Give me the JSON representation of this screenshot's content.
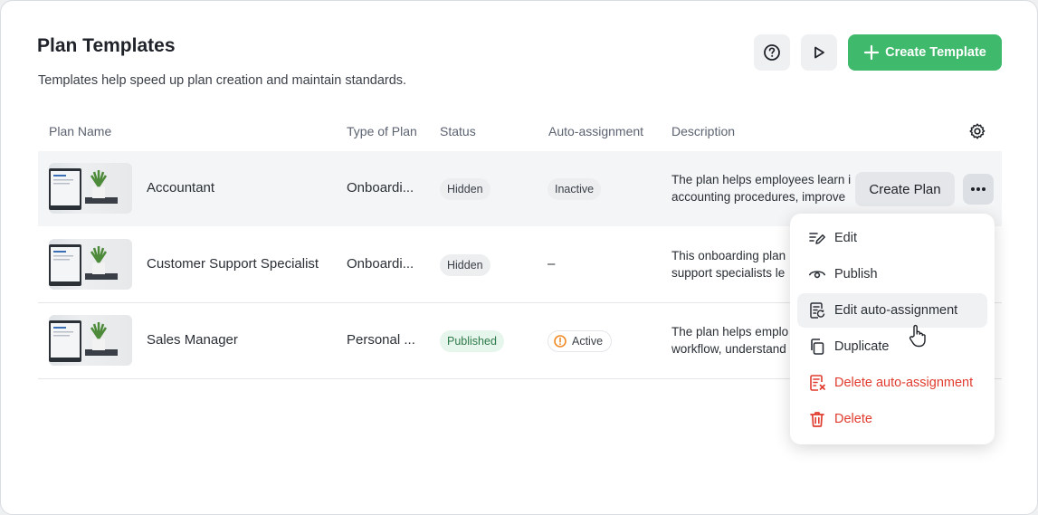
{
  "header": {
    "title": "Plan Templates",
    "subtitle": "Templates help speed up plan creation and maintain standards.",
    "help_icon": "question-circle-icon",
    "play_icon": "play-icon",
    "create_label": "Create Template"
  },
  "table": {
    "columns": [
      "Plan Name",
      "Type of Plan",
      "Status",
      "Auto-assignment",
      "Description"
    ],
    "rows": [
      {
        "name": "Accountant",
        "type": "Onboardi...",
        "status": "Hidden",
        "auto_assignment": "Inactive",
        "description_line1": "The plan helps employees learn i",
        "description_line2": "accounting procedures, improve"
      },
      {
        "name": "Customer Support Specialist",
        "type": "Onboardi...",
        "status": "Hidden",
        "auto_assignment": "–",
        "description_line1": "This onboarding plan",
        "description_line2": "support specialists le"
      },
      {
        "name": "Sales Manager",
        "type": "Personal ...",
        "status": "Published",
        "auto_assignment": "Active",
        "description_line1": "The plan helps emplo",
        "description_line2": "workflow, understand"
      }
    ]
  },
  "row_actions": {
    "create_plan_label": "Create Plan"
  },
  "menu": {
    "items": [
      {
        "label": "Edit",
        "icon": "edit-icon"
      },
      {
        "label": "Publish",
        "icon": "eye-icon"
      },
      {
        "label": "Edit auto-assignment",
        "icon": "edit-auto-assignment-icon"
      },
      {
        "label": "Duplicate",
        "icon": "copy-icon"
      },
      {
        "label": "Delete auto-assignment",
        "icon": "delete-auto-assignment-icon"
      },
      {
        "label": "Delete",
        "icon": "trash-icon"
      }
    ]
  },
  "colors": {
    "accent": "#3fb96b",
    "danger": "#e03b2e",
    "warning": "#f08a24"
  }
}
